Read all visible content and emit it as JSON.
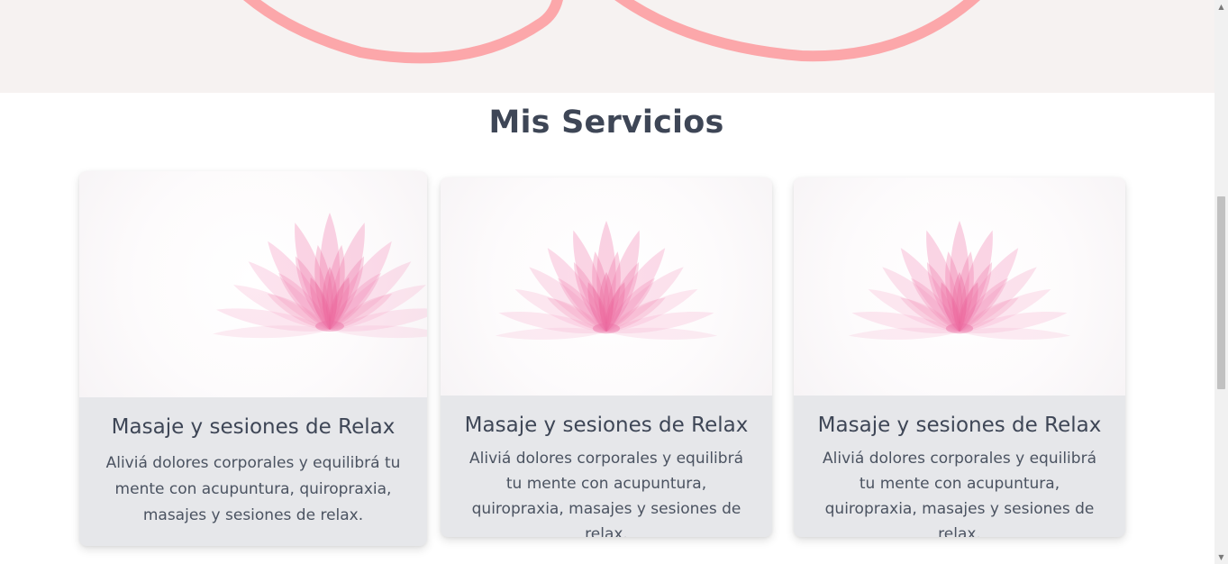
{
  "services": {
    "title": "Mis Servicios",
    "cards": [
      {
        "image_icon": "lotus-flower",
        "title": "Masaje y sesiones de Relax",
        "description": "Aliviá dolores corporales y equilibrá tu mente con acupuntura, quiropraxia, masajes y sesiones de relax."
      },
      {
        "image_icon": "lotus-flower",
        "title": "Masaje y sesiones de Relax",
        "description": "Aliviá dolores corporales y equilibrá tu mente con acupuntura, quiropraxia, masajes y sesiones de relax."
      },
      {
        "image_icon": "lotus-flower",
        "title": "Masaje y sesiones de Relax",
        "description": "Aliviá dolores corporales y equilibrá tu mente con acupuntura, quiropraxia, masajes y sesiones de relax."
      }
    ]
  },
  "colors": {
    "heading": "#3e4656",
    "card_background": "#e6e7ea",
    "lotus_pink": "#ec6fa4",
    "hero_accent": "#fca7aa",
    "hero_background": "#f6f2f1"
  }
}
